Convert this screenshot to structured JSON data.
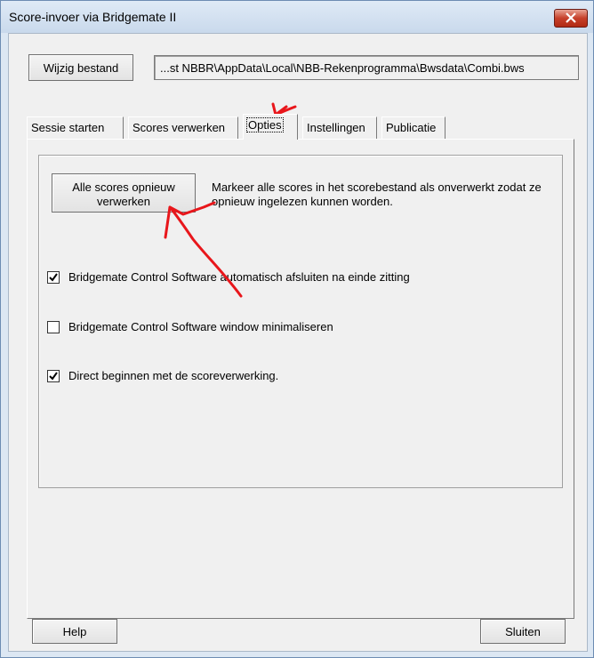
{
  "window": {
    "title": "Score-invoer via Bridgemate II"
  },
  "file": {
    "change_button_label": "Wijzig bestand",
    "path": "...st NBBR\\AppData\\Local\\NBB-Rekenprogramma\\Bwsdata\\Combi.bws"
  },
  "tabs": [
    {
      "label": "Sessie starten"
    },
    {
      "label": "Scores verwerken"
    },
    {
      "label": "Opties",
      "active": true
    },
    {
      "label": "Instellingen"
    },
    {
      "label": "Publicatie"
    }
  ],
  "options": {
    "reprocess_button_label": "Alle scores opnieuw verwerken",
    "reprocess_description": "Markeer alle scores in het scorebestand als onverwerkt zodat ze opnieuw ingelezen kunnen worden.",
    "checkboxes": [
      {
        "label": "Bridgemate Control Software automatisch afsluiten na einde zitting",
        "checked": true
      },
      {
        "label": "Bridgemate Control Software window minimaliseren",
        "checked": false
      },
      {
        "label": "Direct beginnen met de scoreverwerking.",
        "checked": true
      }
    ]
  },
  "footer": {
    "help_label": "Help",
    "close_label": "Sluiten"
  },
  "colors": {
    "annotation": "#e8161b",
    "close_button": "#c6402a",
    "title_bar": "#c9d9ec"
  }
}
